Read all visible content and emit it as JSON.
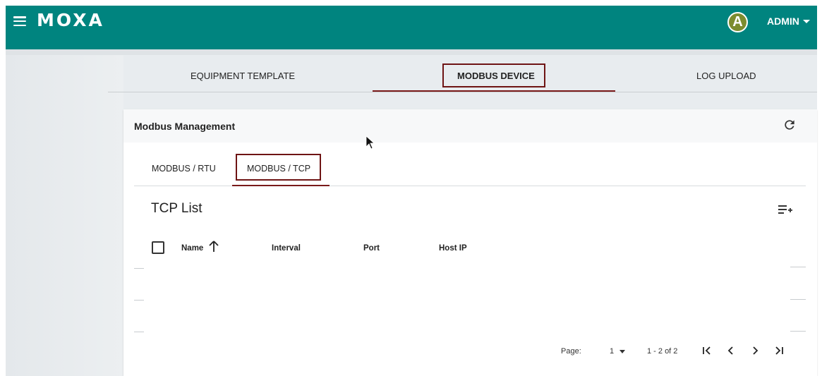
{
  "header": {
    "logo": "MOXA",
    "avatar_letter": "A",
    "user_name": "ADMIN"
  },
  "main_tabs": [
    {
      "label": "EQUIPMENT TEMPLATE"
    },
    {
      "label": "MODBUS DEVICE",
      "active": true
    },
    {
      "label": "LOG UPLOAD"
    }
  ],
  "card": {
    "title": "Modbus Management"
  },
  "sub_tabs": [
    {
      "label": "MODBUS / RTU"
    },
    {
      "label": "MODBUS / TCP",
      "active": true
    }
  ],
  "list": {
    "title": "TCP List",
    "columns": [
      "Name",
      "Interval",
      "Port",
      "Host IP"
    ]
  },
  "pagination": {
    "page_label": "Page:",
    "page_value": "1",
    "range": "1 - 2 of 2"
  },
  "icons": {
    "menu": "hamburger-menu-icon",
    "refresh": "refresh-icon",
    "add_list": "playlist-add-icon",
    "sort": "arrow-up-icon",
    "first": "first-page-icon",
    "prev": "chevron-left-icon",
    "next": "chevron-right-icon",
    "last": "last-page-icon"
  },
  "colors": {
    "brand": "#00847f",
    "highlight": "#6e1414"
  }
}
